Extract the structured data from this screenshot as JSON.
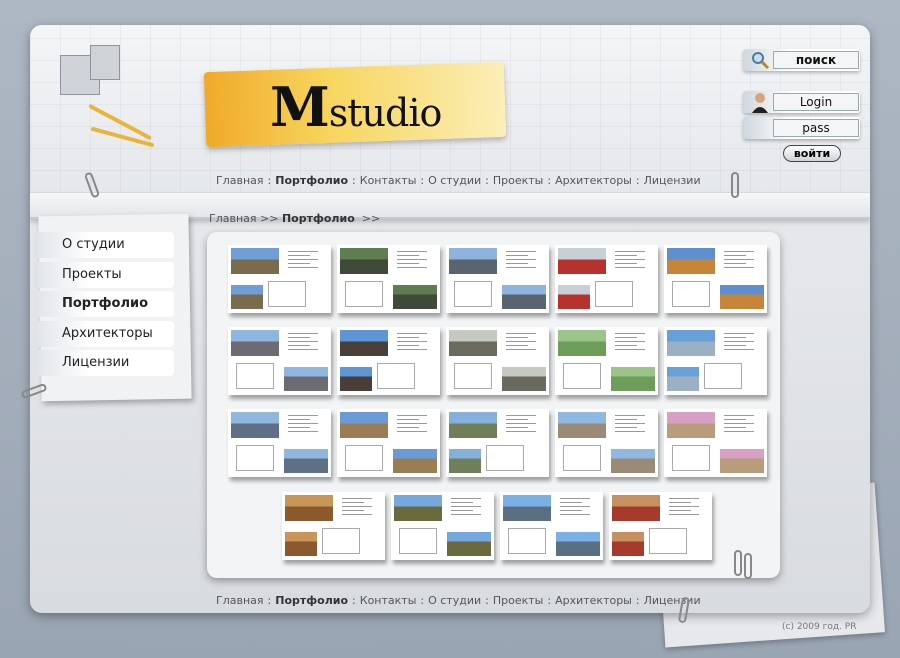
{
  "logo": {
    "text_m": "M",
    "text_rest": "studio"
  },
  "top_nav": {
    "items": [
      "Главная",
      "Портфолио",
      "Контакты",
      "О студии",
      "Проекты",
      "Архитекторы",
      "Лицензии"
    ],
    "active": "Портфолио"
  },
  "breadcrumb": {
    "home": "Главная",
    "sep": ">>",
    "current": "Портфолио",
    "trail": ">>"
  },
  "search": {
    "label": "поиск",
    "icon": "magnifier-icon"
  },
  "login": {
    "login_placeholder": "Login",
    "pass_placeholder": "pass",
    "submit": "войти",
    "icon": "user-avatar-icon"
  },
  "sidebar": {
    "items": [
      {
        "label": "О студии"
      },
      {
        "label": "Проекты"
      },
      {
        "label": "Портфолио",
        "active": true
      },
      {
        "label": "Архитекторы"
      },
      {
        "label": "Лицензии"
      }
    ]
  },
  "portfolio": {
    "thumbnails": [
      {
        "photo": "#7a6a4e",
        "sky": "#6f9fd6"
      },
      {
        "photo": "#3f4a3a",
        "sky": "#5e7d50"
      },
      {
        "photo": "#5a6470",
        "sky": "#8fb3dc"
      },
      {
        "photo": "#b5332c",
        "sky": "#c9cfd6"
      },
      {
        "photo": "#c7853a",
        "sky": "#5d8fd0"
      },
      {
        "photo": "#6e6a74",
        "sky": "#8eb6e0"
      },
      {
        "photo": "#4a3f38",
        "sky": "#5d95d5"
      },
      {
        "photo": "#6b6a5e",
        "sky": "#c6c9c2"
      },
      {
        "photo": "#6e9c5a",
        "sky": "#9bc489"
      },
      {
        "photo": "#9bb0c4",
        "sky": "#6aa0d8"
      },
      {
        "photo": "#5e6f86",
        "sky": "#90b8df"
      },
      {
        "photo": "#9b7d55",
        "sky": "#6b9bd6"
      },
      {
        "photo": "#6f7f5a",
        "sky": "#85b0dc"
      },
      {
        "photo": "#9a8a76",
        "sky": "#8fb9e0"
      },
      {
        "photo": "#b99c7c",
        "sky": "#d9a0c6"
      },
      {
        "photo": "#8a5a2e",
        "sky": "#c79658"
      },
      {
        "photo": "#6b6a3e",
        "sky": "#76a8e0"
      },
      {
        "photo": "#5a6f84",
        "sky": "#7ab0e6"
      },
      {
        "photo": "#a63a2c",
        "sky": "#c79060"
      }
    ]
  },
  "copyright": "(c) 2009 год. PR",
  "colors": {
    "logo_band": "#f5c242",
    "background": "#a4aebb"
  }
}
